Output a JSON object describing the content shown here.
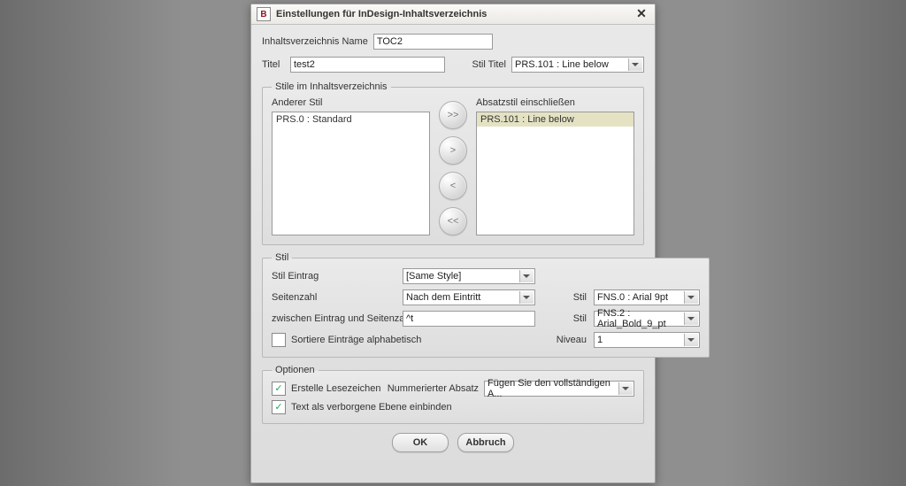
{
  "window": {
    "title": "Einstellungen für InDesign-Inhaltsverzeichnis",
    "icon_letter": "B"
  },
  "top": {
    "name_label": "Inhaltsverzeichnis Name",
    "name_value": "TOC2",
    "title_label": "Titel",
    "title_value": "test2",
    "style_title_label": "Stil Titel",
    "style_title_value": "PRS.101 : Line below"
  },
  "styles_group": {
    "legend": "Stile im Inhaltsverzeichnis",
    "other_label": "Anderer Stil",
    "include_label": "Absatzstil einschließen",
    "other_items": [
      "PRS.0 : Standard"
    ],
    "include_items": [
      "PRS.101 : Line below"
    ],
    "btn_add_all": ">>",
    "btn_add": ">",
    "btn_remove": "<",
    "btn_remove_all": "<<"
  },
  "stil_group": {
    "legend": "Stil",
    "entry_label": "Stil Eintrag",
    "entry_value": "[Same Style]",
    "pagenum_label": "Seitenzahl",
    "pagenum_value": "Nach dem Eintritt",
    "pagenum_style_label": "Stil",
    "pagenum_style_value": "FNS.0 : Arial 9pt",
    "between_label": "zwischen Eintrag und Seitenzahl",
    "between_value": "^t",
    "between_style_label": "Stil",
    "between_style_value": "FNS.2 : Arial_Bold_9_pt",
    "sort_label": "Sortiere Einträge alphabetisch",
    "niveau_label": "Niveau",
    "niveau_value": "1"
  },
  "options_group": {
    "legend": "Optionen",
    "bookmark_label": "Erstelle Lesezeichen",
    "numbered_label": "Nummerierter Absatz",
    "numbered_value": "Fügen Sie den vollständigen A...",
    "hidden_label": "Text als verborgene Ebene einbinden"
  },
  "footer": {
    "ok": "OK",
    "cancel": "Abbruch"
  }
}
